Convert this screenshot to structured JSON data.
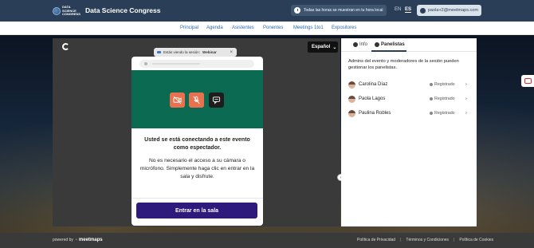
{
  "header": {
    "logo_lines": [
      "DATA",
      "SCIENCE",
      "CONGRESS"
    ],
    "brand": "Data Science Congress",
    "timezone_text": "Todas las horas se muestran en tu hora local",
    "lang_en": "EN",
    "lang_es": "ES",
    "user_email": "paola+2@meetmaps.com"
  },
  "nav": {
    "items": [
      "Principal",
      "Agenda",
      "Asistentes",
      "Ponentes",
      "Meetings 1to1",
      "Expositores"
    ]
  },
  "video": {
    "language": "Español",
    "session_prefix": "Estás viendo la sesión:",
    "session_name": "Webinar",
    "close": "×"
  },
  "modal": {
    "title": "Usted se está conectando a este evento como espectador.",
    "body": "No es necesario el acceso a su cámara o micrófono. Simplemente haga clic en entrar en la sala y disfrute.",
    "enter_label": "Entrar en la sala"
  },
  "panel": {
    "tab_info": "Info",
    "tab_panelists": "Panelistas",
    "description": "Admins del evento y moderadores de la sesión pueden gestionar los panelistas.",
    "panelists": [
      {
        "name": "Carolina Díaz",
        "status": "Registrado"
      },
      {
        "name": "Paola Lagos",
        "status": "Registrado"
      },
      {
        "name": "Paulina Robles",
        "status": "Registrado"
      }
    ]
  },
  "footer": {
    "powered_by": "powered by",
    "powered_brand": "meetmaps",
    "links": [
      "Política de Privacidad",
      "Términos y Condiciones",
      "Política de Cookies"
    ],
    "separator": "|"
  },
  "colors": {
    "header_bg": "#2a3f57",
    "stage_green": "#0b6a52",
    "enter_button": "#2d1a7a",
    "media_button": "#e8724f"
  }
}
